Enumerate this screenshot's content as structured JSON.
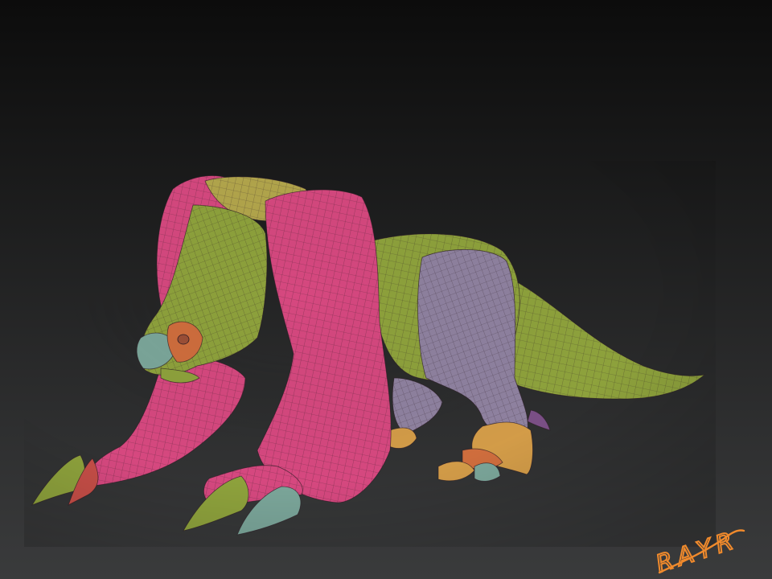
{
  "scene": {
    "description_label": "",
    "background": {
      "top_color": "#0c0c0c",
      "bottom_color": "#3a3b3c"
    },
    "polygroup_colors": {
      "pink": "#d6487f",
      "lime": "#8ea23c",
      "olive": "#b3a64c",
      "lavender": "#8f82a0",
      "orange": "#cf6d3d",
      "teal": "#7ba69a",
      "amber": "#d39c48",
      "red": "#c64e47",
      "violet": "#7a4f86",
      "wire": "#2b1b24"
    }
  },
  "watermark": {
    "text": "RAYR",
    "color": "#f08a2c"
  }
}
